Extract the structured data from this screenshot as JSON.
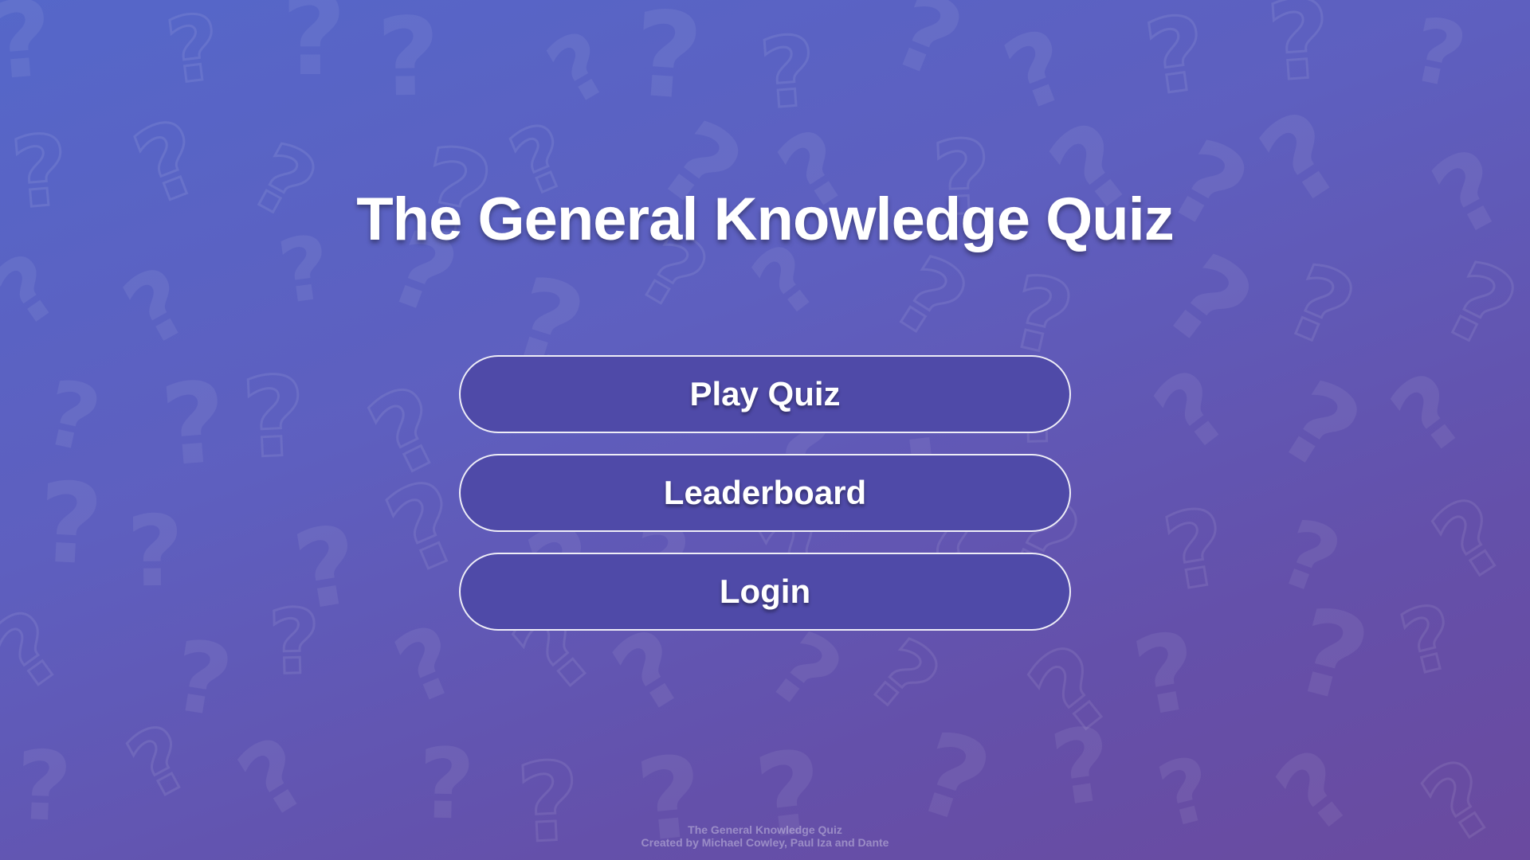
{
  "page": {
    "title": "The General Knowledge Quiz"
  },
  "menu": {
    "play_label": "Play Quiz",
    "leaderboard_label": "Leaderboard",
    "login_label": "Login"
  },
  "footer": {
    "line1": "The General Knowledge Quiz",
    "line2": "Created by Michael Cowley, Paul Iza and Dante"
  },
  "colors": {
    "background_start": "#5567c9",
    "background_end": "#6a4a9f",
    "button_fill": "#4f4aa8",
    "button_border": "#ffffff",
    "text": "#ffffff"
  },
  "background_icon": "question-mark-icon"
}
